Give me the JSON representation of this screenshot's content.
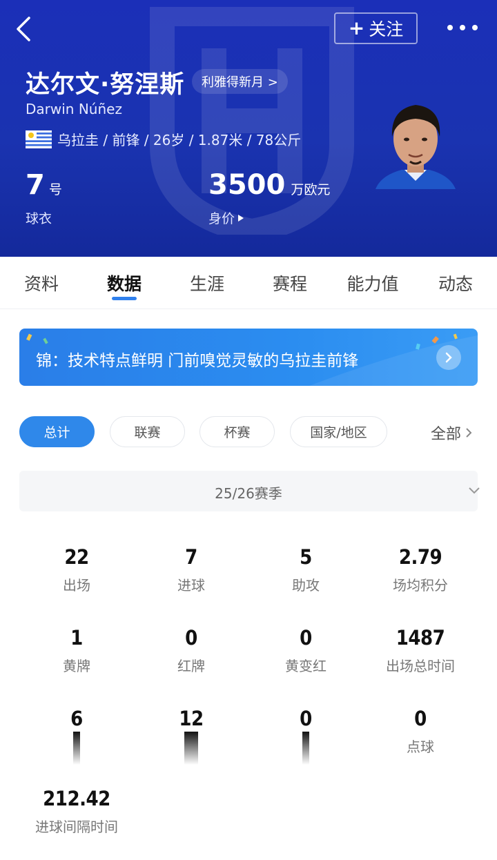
{
  "header": {
    "name_cn": "达尔文·努涅斯",
    "name_en": "Darwin Núñez",
    "team_chip": "利雅得新月 >",
    "follow_label": "关注",
    "info_line": "乌拉圭 / 前锋 / 26岁 / 1.87米 / 78公斤",
    "shirt_number": "7",
    "shirt_unit": "号",
    "shirt_label": "球衣",
    "market_value": "3500",
    "market_unit": "万欧元",
    "market_label": "身价"
  },
  "tabs": [
    "资料",
    "数据",
    "生涯",
    "赛程",
    "能力值",
    "动态"
  ],
  "active_tab": "数据",
  "banner": {
    "text": "锦：技术特点鲜明 门前嗅觉灵敏的乌拉圭前锋"
  },
  "filters": [
    "总计",
    "联赛",
    "杯赛",
    "国家/地区"
  ],
  "active_filter": "总计",
  "filter_all_label": "全部",
  "season": "25/26赛季",
  "stats": [
    {
      "value": "22",
      "label": "出场"
    },
    {
      "value": "7",
      "label": "进球"
    },
    {
      "value": "5",
      "label": "助攻"
    },
    {
      "value": "2.79",
      "label": "场均积分"
    },
    {
      "value": "1",
      "label": "黄牌"
    },
    {
      "value": "0",
      "label": "红牌"
    },
    {
      "value": "0",
      "label": "黄变红"
    },
    {
      "value": "1487",
      "label": "出场总时间"
    },
    {
      "value": "6",
      "label": ""
    },
    {
      "value": "12",
      "label": ""
    },
    {
      "value": "0",
      "label": ""
    },
    {
      "value": "0",
      "label": "点球"
    },
    {
      "value": "212.42",
      "label": "进球间隔时间"
    }
  ],
  "colors": {
    "header_bg": "#1a33b0",
    "accent_blue": "#2f88ea",
    "tab_indicator": "#2f80ed"
  },
  "icons": [
    "back-arrow-icon",
    "plus-icon",
    "more-dots-icon",
    "uruguay-flag-icon",
    "caret-right-icon",
    "chevron-right-icon",
    "chevron-down-icon",
    "club-crest-watermark"
  ]
}
